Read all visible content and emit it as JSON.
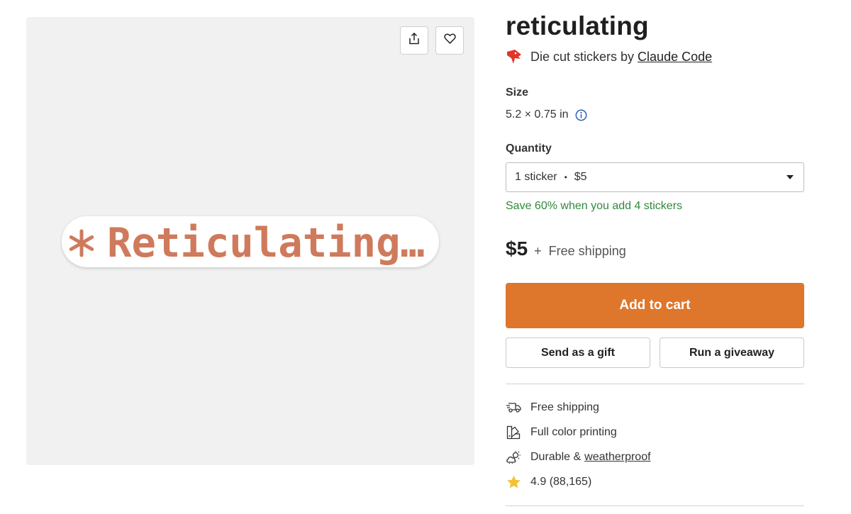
{
  "product": {
    "title": "reticulating",
    "byline_prefix": "Die cut stickers by",
    "artist": "Claude Code",
    "brand_logo_icon": "red-bird-logo-icon",
    "brand_color": "#e4352b"
  },
  "image": {
    "sticker_text": "Reticulating…",
    "sticker_color": "#cf7a5c",
    "share_icon": "share-icon",
    "favorite_icon": "heart-icon",
    "background": "#f1f1f1"
  },
  "size": {
    "label": "Size",
    "value": "5.2 × 0.75 in",
    "info_icon": "info-icon"
  },
  "quantity": {
    "label": "Quantity",
    "selected_count": "1 sticker",
    "selected_price": "$5",
    "separator": "•"
  },
  "promo": {
    "text": "Save 60% when you add 4 stickers",
    "color": "#2f8a3a"
  },
  "pricing": {
    "price": "$5",
    "plus": "+",
    "shipping": "Free shipping"
  },
  "actions": {
    "add_to_cart": "Add to cart",
    "add_to_cart_color": "#de762c",
    "send_gift": "Send as a gift",
    "giveaway": "Run a giveaway"
  },
  "features": [
    {
      "icon": "truck-icon",
      "text": "Free shipping"
    },
    {
      "icon": "color-swatch-icon",
      "text": "Full color printing"
    },
    {
      "icon": "weather-icon",
      "text_prefix": "Durable &",
      "link": "weatherproof"
    },
    {
      "icon": "star-icon",
      "text": "4.9 (88,165)",
      "star_color": "#f3c233"
    }
  ]
}
